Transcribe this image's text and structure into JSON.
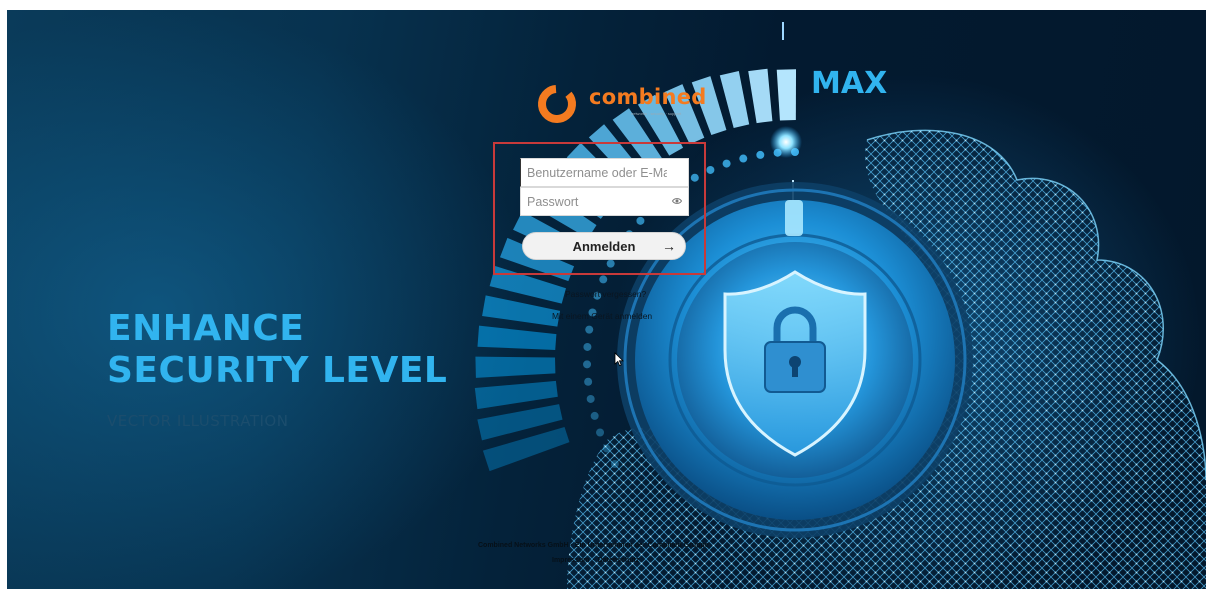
{
  "hero": {
    "headline_line1": "ENHANCE",
    "headline_line2": "SECURITY LEVEL",
    "subline": "VECTOR ILLUSTRATION",
    "dial_label": "MAX"
  },
  "brand": {
    "name": "combined",
    "tagline": "networks · security · support",
    "logo_icon": "combined-logo-icon",
    "accent_color": "#f47b20"
  },
  "login": {
    "username_placeholder": "Benutzername oder E-Mail",
    "username_value": "",
    "password_placeholder": "Passwort",
    "password_value": "",
    "submit_label": "Anmelden",
    "submit_icon": "arrow-right-icon",
    "forgot_password_link": "Passwort vergessen?",
    "device_login_link": "Mit einem Gerät anmelden",
    "highlight_color": "#c83a3a"
  },
  "footer": {
    "company_line": "Combined Networks GmbH · Ein Unternehmen der Combined Gruppe",
    "imprint_link": "Impressum",
    "privacy_link": "Datenschutz"
  },
  "colors": {
    "headline": "#31b4ef",
    "background": "#04223a"
  }
}
